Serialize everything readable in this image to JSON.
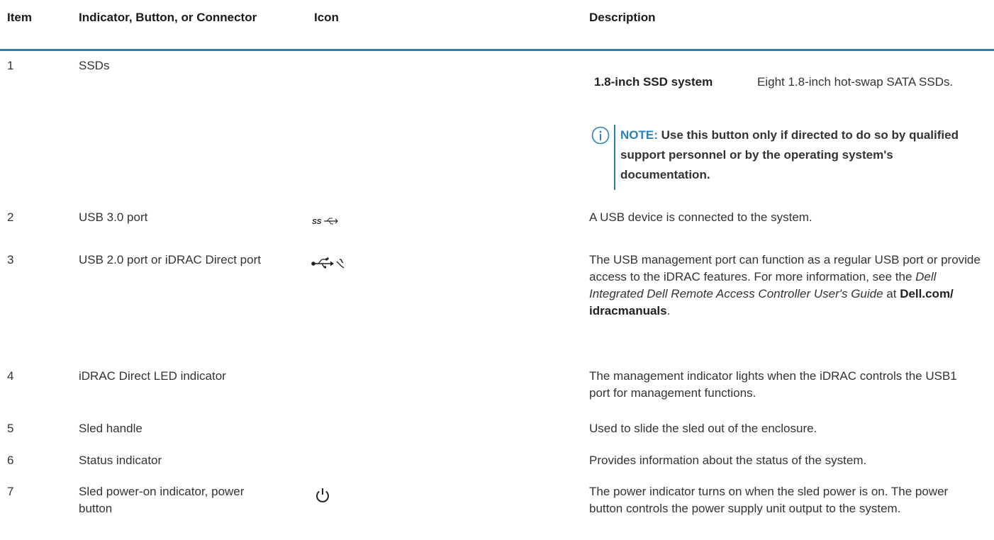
{
  "header": {
    "item": "Item",
    "indicator": "Indicator, Button, or Connector",
    "icon": "Icon",
    "description": "Description"
  },
  "rows": [
    {
      "item": "1",
      "name": "SSDs",
      "icon": null,
      "sub": {
        "term": "1.8-inch SSD system",
        "text": "Eight 1.8-inch hot-swap SATA SSDs."
      },
      "note": {
        "label": "NOTE:",
        "text": "Use this button only if directed to do so by qualified support personnel or by the operating system's documentation."
      }
    },
    {
      "item": "2",
      "name": "USB 3.0 port",
      "icon": "usb-3-ss-icon",
      "description": "A USB device is connected to the system."
    },
    {
      "item": "3",
      "name": "USB 2.0 port or iDRAC Direct port",
      "icon": "usb-management-icon",
      "description_parts": {
        "p1": "The USB management port can function as a regular USB port or provide access to the iDRAC features. For more information, see the ",
        "guide": "Dell Integrated Dell Remote Access Controller User's Guide",
        "at": " at ",
        "link": "Dell.com/ idracmanuals",
        "end": "."
      }
    },
    {
      "item": "4",
      "name": "iDRAC Direct LED indicator",
      "icon": null,
      "description": "The management indicator lights when the iDRAC controls the USB1 port for management functions."
    },
    {
      "item": "5",
      "name": "Sled handle",
      "icon": null,
      "description": "Used to slide the sled out of the enclosure."
    },
    {
      "item": "6",
      "name": "Status indicator",
      "icon": null,
      "description": "Provides information about the status of the system."
    },
    {
      "item": "7",
      "name": "Sled power-on indicator, power button",
      "icon": "power-icon",
      "description": "The power indicator turns on when the sled power is on. The power button controls the power supply unit output to the system."
    }
  ],
  "colors": {
    "accent": "#2e7fb4",
    "text": "#333333"
  }
}
